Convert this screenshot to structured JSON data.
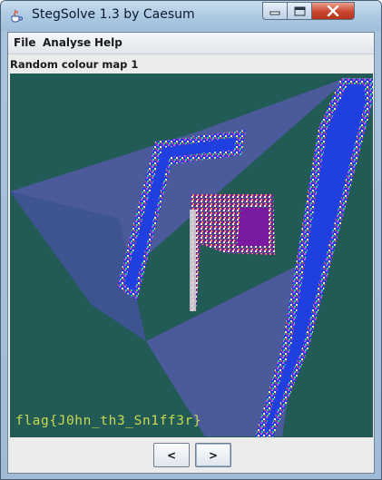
{
  "window": {
    "title": "StegSolve 1.3 by Caesum",
    "icon": "java-cup-icon",
    "controls": {
      "minimize": "minimize-icon",
      "maximize": "maximize-icon",
      "close": "close-icon"
    }
  },
  "menu": {
    "items": [
      {
        "label": "File"
      },
      {
        "label": "Analyse"
      },
      {
        "label": "Help"
      }
    ]
  },
  "panel": {
    "label": "Random colour map 1"
  },
  "image": {
    "hidden_text": "flag{J0hn_th3_Sn1ff3r}",
    "colors": {
      "background": "#225a55",
      "triangles": "#4a5a9a",
      "stripe_blue": "#1f3fe0",
      "flag_purple": "#7a1aa0",
      "text": "#c9d94f"
    }
  },
  "navigation": {
    "prev_label": "<",
    "next_label": ">"
  }
}
